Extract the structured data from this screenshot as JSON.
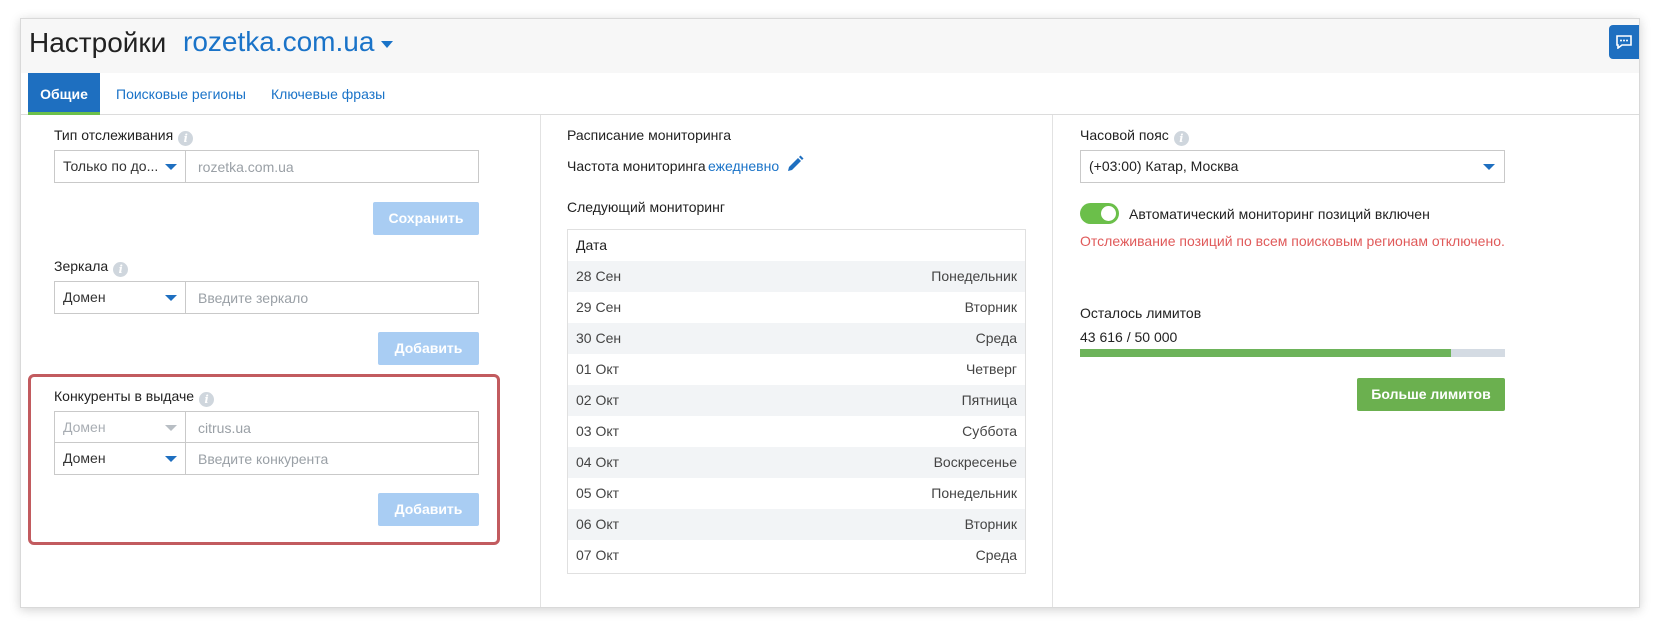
{
  "header": {
    "title": "Настройки",
    "site": "rozetka.com.ua"
  },
  "tabs": [
    {
      "label": "Общие",
      "active": true
    },
    {
      "label": "Поисковые регионы",
      "active": false
    },
    {
      "label": "Ключевые фразы",
      "active": false
    }
  ],
  "tracking": {
    "label": "Тип отслеживания",
    "select_value": "Только по до...",
    "input_placeholder": "rozetka.com.ua",
    "save_label": "Сохранить"
  },
  "mirrors": {
    "label": "Зеркала",
    "select_value": "Домен",
    "input_placeholder": "Введите зеркало",
    "add_label": "Добавить"
  },
  "competitors": {
    "label": "Конкуренты в выдаче",
    "existing": {
      "select_value": "Домен",
      "input_value": "citrus.ua"
    },
    "new": {
      "select_value": "Домен",
      "input_placeholder": "Введите конкурента"
    },
    "add_label": "Добавить"
  },
  "schedule": {
    "label": "Расписание мониторинга",
    "frequency_label": "Частота мониторинга",
    "frequency_value": "ежедневно",
    "next_label": "Следующий мониторинг",
    "table_header": "Дата",
    "rows": [
      {
        "date": "28 Сен",
        "day": "Понедельник"
      },
      {
        "date": "29 Сен",
        "day": "Вторник"
      },
      {
        "date": "30 Сен",
        "day": "Среда"
      },
      {
        "date": "01 Окт",
        "day": "Четверг"
      },
      {
        "date": "02 Окт",
        "day": "Пятница"
      },
      {
        "date": "03 Окт",
        "day": "Суббота"
      },
      {
        "date": "04 Окт",
        "day": "Воскресенье"
      },
      {
        "date": "05 Окт",
        "day": "Понедельник"
      },
      {
        "date": "06 Окт",
        "day": "Вторник"
      },
      {
        "date": "07 Окт",
        "day": "Среда"
      }
    ]
  },
  "timezone": {
    "label": "Часовой пояс",
    "value": "(+03:00) Катар, Москва"
  },
  "auto_monitoring": {
    "enabled": true,
    "label": "Автоматический мониторинг позиций включен",
    "warning": "Отслеживание позиций по всем поисковым регионам отключено."
  },
  "limits": {
    "label": "Осталось лимитов",
    "value_text": "43 616 / 50 000",
    "used_fraction": 0.87232,
    "more_label": "Больше лимитов"
  },
  "colors": {
    "accent": "#1e6fc0",
    "link": "#1a73c8",
    "success": "#6bb04f",
    "danger": "#e05a5a",
    "highlight": "#c25b5f"
  }
}
